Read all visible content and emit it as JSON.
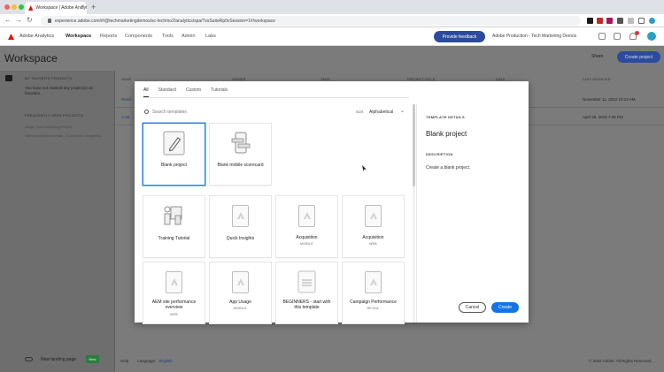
{
  "browser": {
    "tab_title": "Workspace | Adobe Analytics",
    "tab_close": "×",
    "new_tab": "+",
    "url": "experience.adobe.com/#/@techmarketingdemos/sc-techmo2/analytics/spa/?ssSuiteRp0vSession=1#/workspace",
    "back": "←",
    "forward": "→",
    "reload": "↻"
  },
  "app": {
    "name": "Adobe Analytics",
    "nav": [
      "Workspace",
      "Reports",
      "Components",
      "Tools",
      "Admin",
      "Labs"
    ],
    "feedback_label": "Provide feedback",
    "org": "Adobe Production - Tech Marketing Demos"
  },
  "workspace": {
    "title": "Workspace",
    "share_label": "Share",
    "create_project_label": "Create project",
    "sidebar": {
      "favorites_head": "MY FAVORITE PROJECTS",
      "favorites_text_1": "You have not marked any project(s) as",
      "favorites_text_2": "favorites.",
      "frequent_head": "FREQUENTLY USED PROJECTS",
      "frequent_1": "Adobe Tech Marketing Project",
      "frequent_2": "Global Analytics Sample - Commerce (Analysis)...",
      "landing_label": "New landing page",
      "landing_badge": "New"
    },
    "table_headers": [
      "NAME",
      "OWNER",
      "TAGS",
      "PROJECT ROLE",
      "DATA",
      "LAST MODIFIED"
    ],
    "rows": [
      {
        "name": "Retail ...",
        "modified": "November 11, 2022 10:14 AM"
      },
      {
        "name": "Cont ...",
        "modified": "April 28, 2019 7:25 PM"
      }
    ],
    "footer": {
      "help": "Help",
      "language_label": "Language:",
      "language_value": "English",
      "copyright": "© 2022 Adobe. All Rights Reserved."
    }
  },
  "modal": {
    "tabs": [
      "All",
      "Standard",
      "Custom",
      "Tutorials"
    ],
    "active_tab": "All",
    "search_placeholder": "Search templates",
    "sort_label": "Sort",
    "sort_value": "Alphabetical",
    "templates": [
      {
        "label": "Blank project",
        "sub": "",
        "icon": "pencil-icon"
      },
      {
        "label": "Blank mobile scorecard",
        "sub": "",
        "icon": "mobile-icon"
      },
      {
        "label": "Training Tutorial",
        "sub": "",
        "icon": "training-icon"
      },
      {
        "label": "Quick Insights",
        "sub": "",
        "icon": "adobe-doc-icon"
      },
      {
        "label": "Acquisition",
        "sub": "MOBILE",
        "icon": "adobe-doc-icon"
      },
      {
        "label": "Acquisition",
        "sub": "WEB",
        "icon": "adobe-doc-icon"
      },
      {
        "label": "AEM site performance overview",
        "sub": "WEB",
        "icon": "adobe-doc-icon"
      },
      {
        "label": "App Usage",
        "sub": "MOBILE",
        "icon": "adobe-doc-icon"
      },
      {
        "label": "BEGINNERS - start with this template",
        "sub": "",
        "icon": "text-doc-icon"
      },
      {
        "label": "Campaign Performance",
        "sub": "RETAIL",
        "icon": "adobe-doc-icon"
      }
    ],
    "details": {
      "head": "TEMPLATE DETAILS",
      "title": "Blank project",
      "desc_head": "DESCRIPTION",
      "desc": "Create a blank project."
    },
    "cancel_label": "Cancel",
    "create_label": "Create"
  },
  "colors": {
    "accent": "#1473e6",
    "brand_red": "#eb1000",
    "header_button": "#2c4b9e"
  }
}
